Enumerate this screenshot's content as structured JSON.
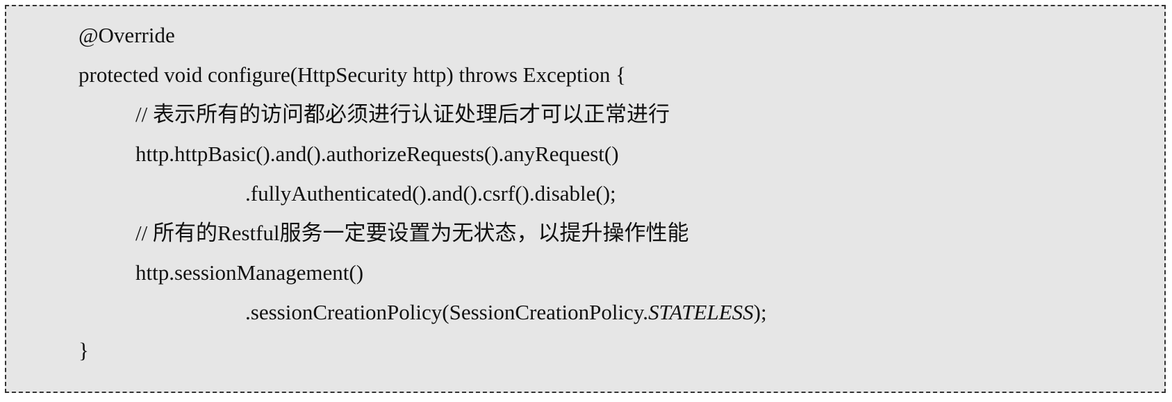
{
  "code": {
    "lines": [
      {
        "text": "@Override"
      },
      {
        "text": "protected void configure(HttpSecurity http) throws Exception {"
      },
      {
        "text": "// 表示所有的访问都必须进行认证处理后才可以正常进行"
      },
      {
        "text": "http.httpBasic().and().authorizeRequests().anyRequest()"
      },
      {
        "text": ".fullyAuthenticated().and().csrf().disable();"
      },
      {
        "text": "// 所有的Restful服务一定要设置为无状态，以提升操作性能"
      },
      {
        "text": "http.sessionManagement()"
      },
      {
        "before": ".sessionCreationPolicy(SessionCreationPolicy.",
        "italic": "STATELESS",
        "after": ");"
      },
      {
        "text": "}"
      }
    ]
  }
}
